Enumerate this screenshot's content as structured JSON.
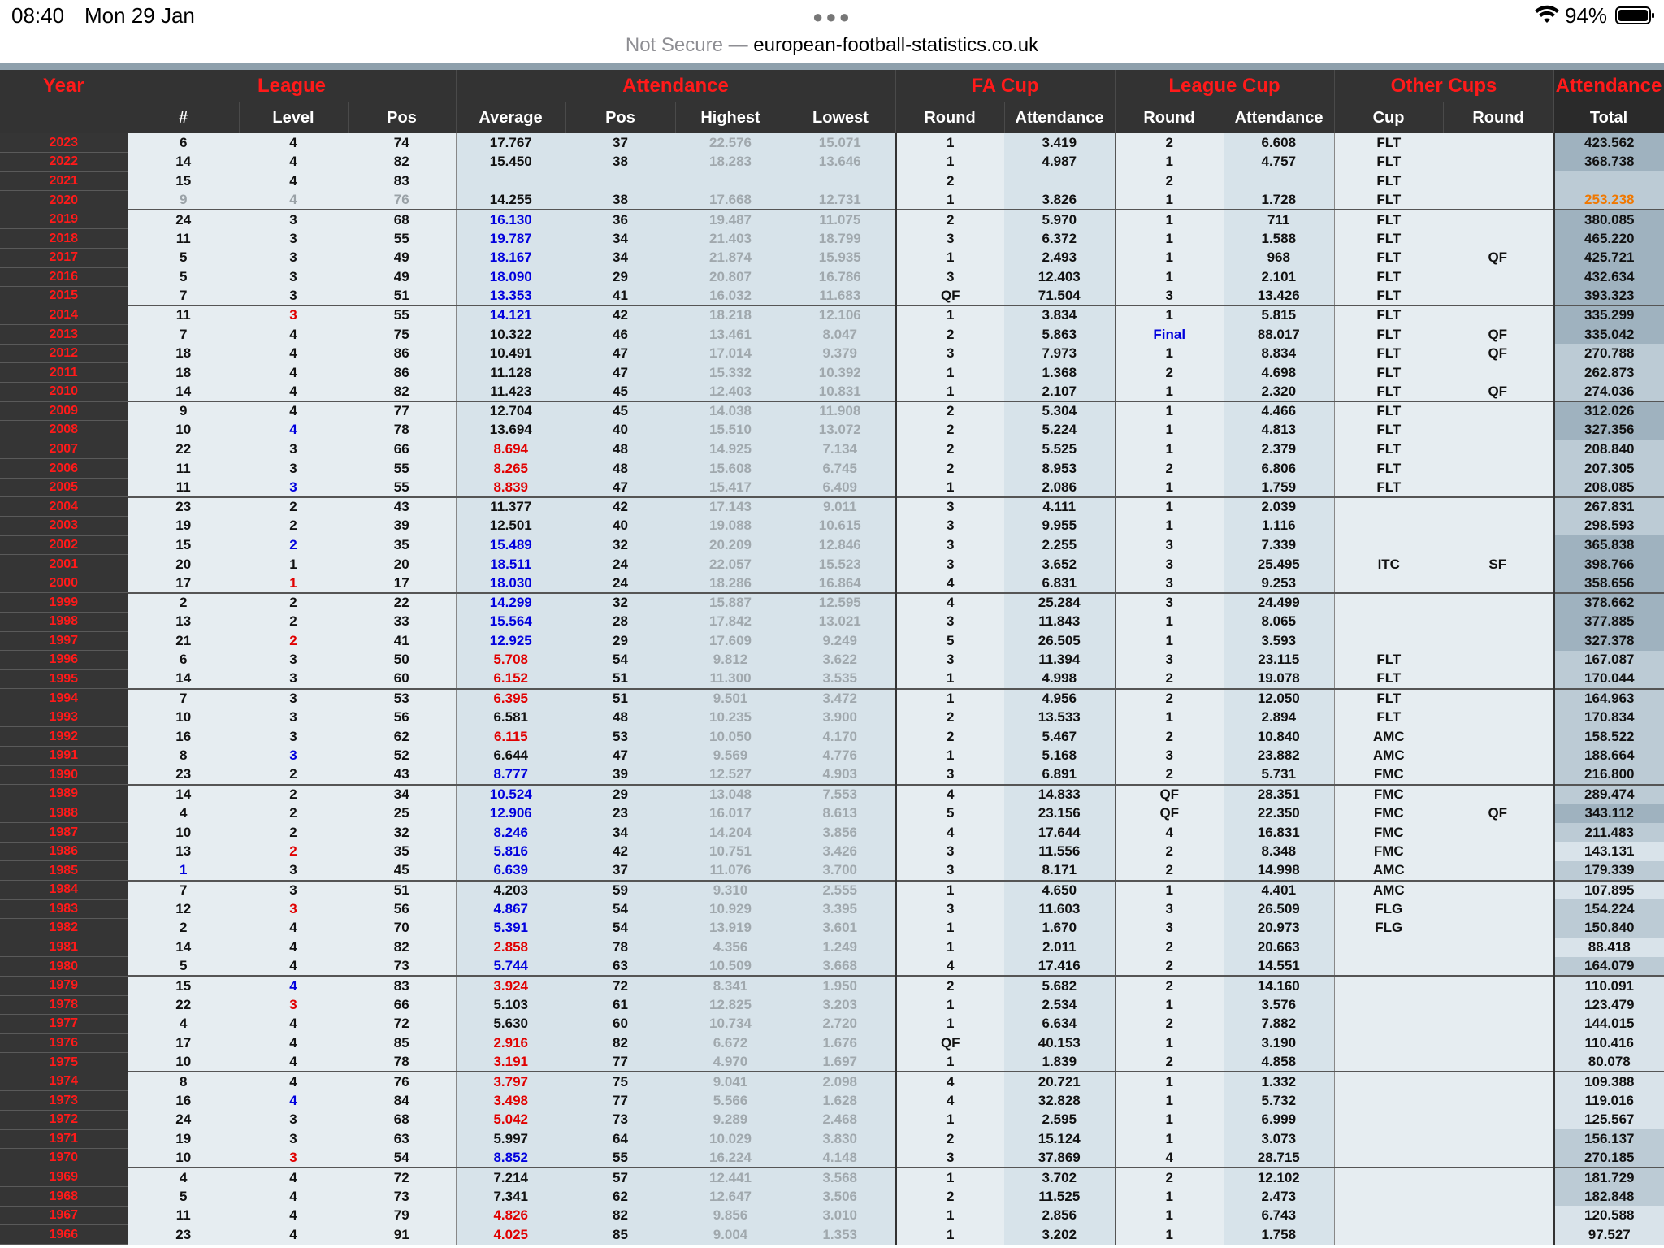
{
  "status_bar": {
    "time": "08:40",
    "date": "Mon 29 Jan",
    "battery": "94%"
  },
  "browser": {
    "not_secure": "Not Secure —",
    "domain": "european-football-statistics.co.uk"
  },
  "header": {
    "groups": [
      "Year",
      "League",
      "Attendance",
      "FA Cup",
      "League Cup",
      "Other Cups",
      "Attendance"
    ],
    "columns": [
      "#",
      "Level",
      "Pos",
      "Average",
      "Pos",
      "Highest",
      "Lowest",
      "Round",
      "Attendance",
      "Round",
      "Attendance",
      "Cup",
      "Round",
      "Total"
    ]
  },
  "colors": {
    "header_red": "#ff1a1a",
    "link_blue": "#0000dd",
    "alert_red": "#e00000",
    "pandemic_orange": "#f07800"
  },
  "rows": [
    [
      "2023",
      "6",
      "4",
      "74",
      "17.767",
      "37",
      "22.576",
      "15.071",
      "1",
      "3.419",
      "2",
      "6.608",
      "FLT",
      "",
      "423.562"
    ],
    [
      "2022",
      "14",
      "4",
      "82",
      "15.450",
      "38",
      "18.283",
      "13.646",
      "1",
      "4.987",
      "1",
      "4.757",
      "FLT",
      "",
      "368.738"
    ],
    [
      "2021",
      "15",
      "4",
      "83",
      "",
      "",
      "",
      "",
      "2",
      "",
      "2",
      "",
      "FLT",
      "",
      ""
    ],
    [
      "2020",
      "9",
      "4",
      "76",
      "14.255",
      "38",
      "17.668",
      "12.731",
      "1",
      "3.826",
      "1",
      "1.728",
      "FLT",
      "",
      "253.238"
    ],
    [
      "2019",
      "24",
      "3",
      "68",
      "16.130",
      "36",
      "19.487",
      "11.075",
      "2",
      "5.970",
      "1",
      "711",
      "FLT",
      "",
      "380.085"
    ],
    [
      "2018",
      "11",
      "3",
      "55",
      "19.787",
      "34",
      "21.403",
      "18.799",
      "3",
      "6.372",
      "1",
      "1.588",
      "FLT",
      "",
      "465.220"
    ],
    [
      "2017",
      "5",
      "3",
      "49",
      "18.167",
      "34",
      "21.874",
      "15.935",
      "1",
      "2.493",
      "1",
      "968",
      "FLT",
      "QF",
      "425.721"
    ],
    [
      "2016",
      "5",
      "3",
      "49",
      "18.090",
      "29",
      "20.807",
      "16.786",
      "3",
      "12.403",
      "1",
      "2.101",
      "FLT",
      "",
      "432.634"
    ],
    [
      "2015",
      "7",
      "3",
      "51",
      "13.353",
      "41",
      "16.032",
      "11.683",
      "QF",
      "71.504",
      "3",
      "13.426",
      "FLT",
      "",
      "393.323"
    ],
    [
      "2014",
      "11",
      "3",
      "55",
      "14.121",
      "42",
      "18.218",
      "12.106",
      "1",
      "3.834",
      "1",
      "5.815",
      "FLT",
      "",
      "335.299"
    ],
    [
      "2013",
      "7",
      "4",
      "75",
      "10.322",
      "46",
      "13.461",
      "8.047",
      "2",
      "5.863",
      "Final",
      "88.017",
      "FLT",
      "QF",
      "335.042"
    ],
    [
      "2012",
      "18",
      "4",
      "86",
      "10.491",
      "47",
      "17.014",
      "9.379",
      "3",
      "7.973",
      "1",
      "8.834",
      "FLT",
      "QF",
      "270.788"
    ],
    [
      "2011",
      "18",
      "4",
      "86",
      "11.128",
      "47",
      "15.332",
      "10.392",
      "1",
      "1.368",
      "2",
      "4.698",
      "FLT",
      "",
      "262.873"
    ],
    [
      "2010",
      "14",
      "4",
      "82",
      "11.423",
      "45",
      "12.403",
      "10.831",
      "1",
      "2.107",
      "1",
      "2.320",
      "FLT",
      "QF",
      "274.036"
    ],
    [
      "2009",
      "9",
      "4",
      "77",
      "12.704",
      "45",
      "14.038",
      "11.908",
      "2",
      "5.304",
      "1",
      "4.466",
      "FLT",
      "",
      "312.026"
    ],
    [
      "2008",
      "10",
      "4",
      "78",
      "13.694",
      "40",
      "15.510",
      "13.072",
      "2",
      "5.224",
      "1",
      "4.813",
      "FLT",
      "",
      "327.356"
    ],
    [
      "2007",
      "22",
      "3",
      "66",
      "8.694",
      "48",
      "14.925",
      "7.134",
      "2",
      "5.525",
      "1",
      "2.379",
      "FLT",
      "",
      "208.840"
    ],
    [
      "2006",
      "11",
      "3",
      "55",
      "8.265",
      "48",
      "15.608",
      "6.745",
      "2",
      "8.953",
      "2",
      "6.806",
      "FLT",
      "",
      "207.305"
    ],
    [
      "2005",
      "11",
      "3",
      "55",
      "8.839",
      "47",
      "15.417",
      "6.409",
      "1",
      "2.086",
      "1",
      "1.759",
      "FLT",
      "",
      "208.085"
    ],
    [
      "2004",
      "23",
      "2",
      "43",
      "11.377",
      "42",
      "17.143",
      "9.011",
      "3",
      "4.111",
      "1",
      "2.039",
      "",
      "",
      "267.831"
    ],
    [
      "2003",
      "19",
      "2",
      "39",
      "12.501",
      "40",
      "19.088",
      "10.615",
      "3",
      "9.955",
      "1",
      "1.116",
      "",
      "",
      "298.593"
    ],
    [
      "2002",
      "15",
      "2",
      "35",
      "15.489",
      "32",
      "20.209",
      "12.846",
      "3",
      "2.255",
      "3",
      "7.339",
      "",
      "",
      "365.838"
    ],
    [
      "2001",
      "20",
      "1",
      "20",
      "18.511",
      "24",
      "22.057",
      "15.523",
      "3",
      "3.652",
      "3",
      "25.495",
      "ITC",
      "SF",
      "398.766"
    ],
    [
      "2000",
      "17",
      "1",
      "17",
      "18.030",
      "24",
      "18.286",
      "16.864",
      "4",
      "6.831",
      "3",
      "9.253",
      "",
      "",
      "358.656"
    ],
    [
      "1999",
      "2",
      "2",
      "22",
      "14.299",
      "32",
      "15.887",
      "12.595",
      "4",
      "25.284",
      "3",
      "24.499",
      "",
      "",
      "378.662"
    ],
    [
      "1998",
      "13",
      "2",
      "33",
      "15.564",
      "28",
      "17.842",
      "13.021",
      "3",
      "11.843",
      "1",
      "8.065",
      "",
      "",
      "377.885"
    ],
    [
      "1997",
      "21",
      "2",
      "41",
      "12.925",
      "29",
      "17.609",
      "9.249",
      "5",
      "26.505",
      "1",
      "3.593",
      "",
      "",
      "327.378"
    ],
    [
      "1996",
      "6",
      "3",
      "50",
      "5.708",
      "54",
      "9.812",
      "3.622",
      "3",
      "11.394",
      "3",
      "23.115",
      "FLT",
      "",
      "167.087"
    ],
    [
      "1995",
      "14",
      "3",
      "60",
      "6.152",
      "51",
      "11.300",
      "3.535",
      "1",
      "4.998",
      "2",
      "19.078",
      "FLT",
      "",
      "170.044"
    ],
    [
      "1994",
      "7",
      "3",
      "53",
      "6.395",
      "51",
      "9.501",
      "3.472",
      "1",
      "4.956",
      "2",
      "12.050",
      "FLT",
      "",
      "164.963"
    ],
    [
      "1993",
      "10",
      "3",
      "56",
      "6.581",
      "48",
      "10.235",
      "3.900",
      "2",
      "13.533",
      "1",
      "2.894",
      "FLT",
      "",
      "170.834"
    ],
    [
      "1992",
      "16",
      "3",
      "62",
      "6.115",
      "53",
      "10.050",
      "4.170",
      "2",
      "5.467",
      "2",
      "10.840",
      "AMC",
      "",
      "158.522"
    ],
    [
      "1991",
      "8",
      "3",
      "52",
      "6.644",
      "47",
      "9.569",
      "4.776",
      "1",
      "5.168",
      "3",
      "23.882",
      "AMC",
      "",
      "188.664"
    ],
    [
      "1990",
      "23",
      "2",
      "43",
      "8.777",
      "39",
      "12.527",
      "4.903",
      "3",
      "6.891",
      "2",
      "5.731",
      "FMC",
      "",
      "216.800"
    ],
    [
      "1989",
      "14",
      "2",
      "34",
      "10.524",
      "29",
      "13.048",
      "7.553",
      "4",
      "14.833",
      "QF",
      "28.351",
      "FMC",
      "",
      "289.474"
    ],
    [
      "1988",
      "4",
      "2",
      "25",
      "12.906",
      "23",
      "16.017",
      "8.613",
      "5",
      "23.156",
      "QF",
      "22.350",
      "FMC",
      "QF",
      "343.112"
    ],
    [
      "1987",
      "10",
      "2",
      "32",
      "8.246",
      "34",
      "14.204",
      "3.856",
      "4",
      "17.644",
      "4",
      "16.831",
      "FMC",
      "",
      "211.483"
    ],
    [
      "1986",
      "13",
      "2",
      "35",
      "5.816",
      "42",
      "10.751",
      "3.426",
      "3",
      "11.556",
      "2",
      "8.348",
      "FMC",
      "",
      "143.131"
    ],
    [
      "1985",
      "1",
      "3",
      "45",
      "6.639",
      "37",
      "11.076",
      "3.700",
      "3",
      "8.171",
      "2",
      "14.998",
      "AMC",
      "",
      "179.339"
    ],
    [
      "1984",
      "7",
      "3",
      "51",
      "4.203",
      "59",
      "9.310",
      "2.555",
      "1",
      "4.650",
      "1",
      "4.401",
      "AMC",
      "",
      "107.895"
    ],
    [
      "1983",
      "12",
      "3",
      "56",
      "4.867",
      "54",
      "10.929",
      "3.395",
      "3",
      "11.603",
      "3",
      "26.509",
      "FLG",
      "",
      "154.224"
    ],
    [
      "1982",
      "2",
      "4",
      "70",
      "5.391",
      "54",
      "13.919",
      "3.601",
      "1",
      "1.670",
      "3",
      "20.973",
      "FLG",
      "",
      "150.840"
    ],
    [
      "1981",
      "14",
      "4",
      "82",
      "2.858",
      "78",
      "4.356",
      "1.249",
      "1",
      "2.011",
      "2",
      "20.663",
      "",
      "",
      "88.418"
    ],
    [
      "1980",
      "5",
      "4",
      "73",
      "5.744",
      "63",
      "10.509",
      "3.668",
      "4",
      "17.416",
      "2",
      "14.551",
      "",
      "",
      "164.079"
    ],
    [
      "1979",
      "15",
      "4",
      "83",
      "3.924",
      "72",
      "8.341",
      "1.950",
      "2",
      "5.682",
      "2",
      "14.160",
      "",
      "",
      "110.091"
    ],
    [
      "1978",
      "22",
      "3",
      "66",
      "5.103",
      "61",
      "12.825",
      "3.203",
      "1",
      "2.534",
      "1",
      "3.576",
      "",
      "",
      "123.479"
    ],
    [
      "1977",
      "4",
      "4",
      "72",
      "5.630",
      "60",
      "10.734",
      "2.720",
      "1",
      "6.634",
      "2",
      "7.882",
      "",
      "",
      "144.015"
    ],
    [
      "1976",
      "17",
      "4",
      "85",
      "2.916",
      "82",
      "6.672",
      "1.676",
      "QF",
      "40.153",
      "1",
      "3.190",
      "",
      "",
      "110.416"
    ],
    [
      "1975",
      "10",
      "4",
      "78",
      "3.191",
      "77",
      "4.970",
      "1.697",
      "1",
      "1.839",
      "2",
      "4.858",
      "",
      "",
      "80.078"
    ],
    [
      "1974",
      "8",
      "4",
      "76",
      "3.797",
      "75",
      "9.041",
      "2.098",
      "4",
      "20.721",
      "1",
      "1.332",
      "",
      "",
      "109.388"
    ],
    [
      "1973",
      "16",
      "4",
      "84",
      "3.498",
      "77",
      "5.566",
      "1.628",
      "4",
      "32.828",
      "1",
      "5.732",
      "",
      "",
      "119.016"
    ],
    [
      "1972",
      "24",
      "3",
      "68",
      "5.042",
      "73",
      "9.289",
      "2.468",
      "1",
      "2.595",
      "1",
      "6.999",
      "",
      "",
      "125.567"
    ],
    [
      "1971",
      "19",
      "3",
      "63",
      "5.997",
      "64",
      "10.029",
      "3.830",
      "2",
      "15.124",
      "1",
      "3.073",
      "",
      "",
      "156.137"
    ],
    [
      "1970",
      "10",
      "3",
      "54",
      "8.852",
      "55",
      "16.224",
      "4.148",
      "3",
      "37.869",
      "4",
      "28.715",
      "",
      "",
      "270.185"
    ],
    [
      "1969",
      "4",
      "4",
      "72",
      "7.214",
      "57",
      "12.441",
      "3.568",
      "1",
      "3.702",
      "2",
      "12.102",
      "",
      "",
      "181.729"
    ],
    [
      "1968",
      "5",
      "4",
      "73",
      "7.341",
      "62",
      "12.647",
      "3.506",
      "2",
      "11.525",
      "1",
      "2.473",
      "",
      "",
      "182.848"
    ],
    [
      "1967",
      "11",
      "4",
      "79",
      "4.826",
      "82",
      "9.856",
      "3.010",
      "1",
      "2.856",
      "1",
      "6.743",
      "",
      "",
      "120.588"
    ],
    [
      "1966",
      "23",
      "4",
      "91",
      "4.025",
      "85",
      "9.004",
      "1.353",
      "1",
      "3.202",
      "1",
      "1.758",
      "",
      "",
      "97.527"
    ]
  ]
}
